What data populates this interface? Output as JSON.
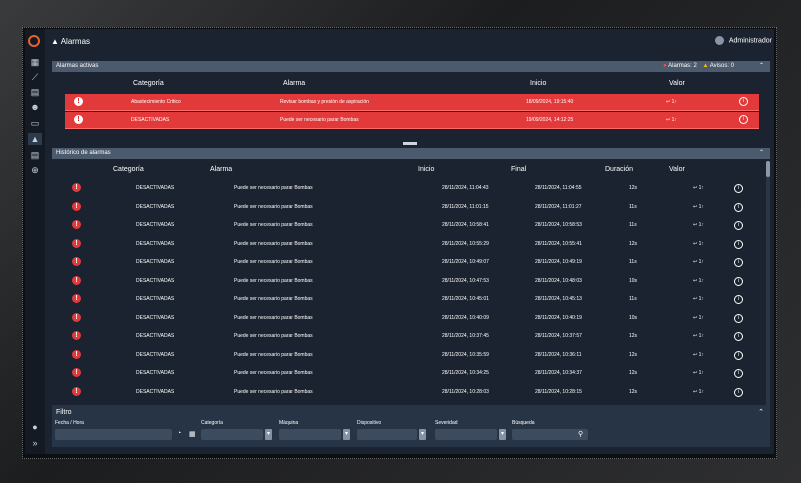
{
  "app": {
    "title": "Alarmas",
    "user": "Administrador"
  },
  "sidebar": {
    "icons": [
      "dashboard-icon",
      "chart-icon",
      "document-icon",
      "users-icon",
      "chat-icon",
      "warning-icon",
      "report-icon",
      "settings-icon",
      "info-icon",
      "expand-icon"
    ]
  },
  "active": {
    "header": "Alarmas activas",
    "alarms_badge": "Alarmas: 2",
    "warnings_badge": "Avisos: 0",
    "columns": {
      "categoria": "Categoría",
      "alarma": "Alarma",
      "inicio": "Inicio",
      "valor": "Valor"
    },
    "rows": [
      {
        "categoria": "Abastecimiento Critico",
        "alarma": "Revisar bombas y presión de aspiración",
        "inicio": "18/09/2024, 19:15:40",
        "valor": "↩ 1↑"
      },
      {
        "categoria": "DESACTIVADAS",
        "alarma": "Puede ser necesario parar Bombas",
        "inicio": "19/09/2024, 14:12:25",
        "valor": "↩ 1↑"
      }
    ]
  },
  "history": {
    "header": "Histórico de alarmas",
    "columns": {
      "categoria": "Categoría",
      "alarma": "Alarma",
      "inicio": "Inicio",
      "final": "Final",
      "duracion": "Duración",
      "valor": "Valor"
    },
    "rows": [
      {
        "categoria": "DESACTIVADAS",
        "alarma": "Puede ser necesario parar Bombas",
        "inicio": "28/11/2024, 11:04:43",
        "final": "28/11/2024, 11:04:55",
        "duracion": "12s",
        "valor": "↩ 1↑"
      },
      {
        "categoria": "DESACTIVADAS",
        "alarma": "Puede ser necesario parar Bombas",
        "inicio": "28/11/2024, 11:01:15",
        "final": "28/11/2024, 11:01:27",
        "duracion": "11s",
        "valor": "↩ 1↑"
      },
      {
        "categoria": "DESACTIVADAS",
        "alarma": "Puede ser necesario parar Bombas",
        "inicio": "28/11/2024, 10:58:41",
        "final": "28/11/2024, 10:58:53",
        "duracion": "11s",
        "valor": "↩ 1↑"
      },
      {
        "categoria": "DESACTIVADAS",
        "alarma": "Puede ser necesario parar Bombas",
        "inicio": "28/11/2024, 10:55:29",
        "final": "28/11/2024, 10:55:41",
        "duracion": "12s",
        "valor": "↩ 1↑"
      },
      {
        "categoria": "DESACTIVADAS",
        "alarma": "Puede ser necesario parar Bombas",
        "inicio": "28/11/2024, 10:49:07",
        "final": "28/11/2024, 10:49:19",
        "duracion": "11s",
        "valor": "↩ 1↑"
      },
      {
        "categoria": "DESACTIVADAS",
        "alarma": "Puede ser necesario parar Bombas",
        "inicio": "28/11/2024, 10:47:53",
        "final": "28/11/2024, 10:48:03",
        "duracion": "10s",
        "valor": "↩ 1↑"
      },
      {
        "categoria": "DESACTIVADAS",
        "alarma": "Puede ser necesario parar Bombas",
        "inicio": "28/11/2024, 10:45:01",
        "final": "28/11/2024, 10:45:13",
        "duracion": "11s",
        "valor": "↩ 1↑"
      },
      {
        "categoria": "DESACTIVADAS",
        "alarma": "Puede ser necesario parar Bombas",
        "inicio": "28/11/2024, 10:40:09",
        "final": "28/11/2024, 10:40:19",
        "duracion": "10s",
        "valor": "↩ 1↑"
      },
      {
        "categoria": "DESACTIVADAS",
        "alarma": "Puede ser necesario parar Bombas",
        "inicio": "28/11/2024, 10:37:45",
        "final": "28/11/2024, 10:37:57",
        "duracion": "12s",
        "valor": "↩ 1↑"
      },
      {
        "categoria": "DESACTIVADAS",
        "alarma": "Puede ser necesario parar Bombas",
        "inicio": "28/11/2024, 10:35:59",
        "final": "28/11/2024, 10:36:11",
        "duracion": "12s",
        "valor": "↩ 1↑"
      },
      {
        "categoria": "DESACTIVADAS",
        "alarma": "Puede ser necesario parar Bombas",
        "inicio": "28/11/2024, 10:34:25",
        "final": "28/11/2024, 10:34:37",
        "duracion": "12s",
        "valor": "↩ 1↑"
      },
      {
        "categoria": "DESACTIVADAS",
        "alarma": "Puede ser necesario parar Bombas",
        "inicio": "28/11/2024, 10:28:03",
        "final": "28/11/2024, 10:28:15",
        "duracion": "12s",
        "valor": "↩ 1↑"
      }
    ]
  },
  "filter": {
    "title": "Filtro",
    "labels": {
      "fecha": "Fecha / Hora",
      "categoria": "Categoría",
      "maquina": "Máquina",
      "dispositivo": "Dispositivo",
      "severidad": "Severidad",
      "busqueda": "Búsqueda"
    }
  },
  "colors": {
    "accent": "#e23a3a",
    "panel": "#1b2330",
    "header": "#4b5a6c"
  }
}
